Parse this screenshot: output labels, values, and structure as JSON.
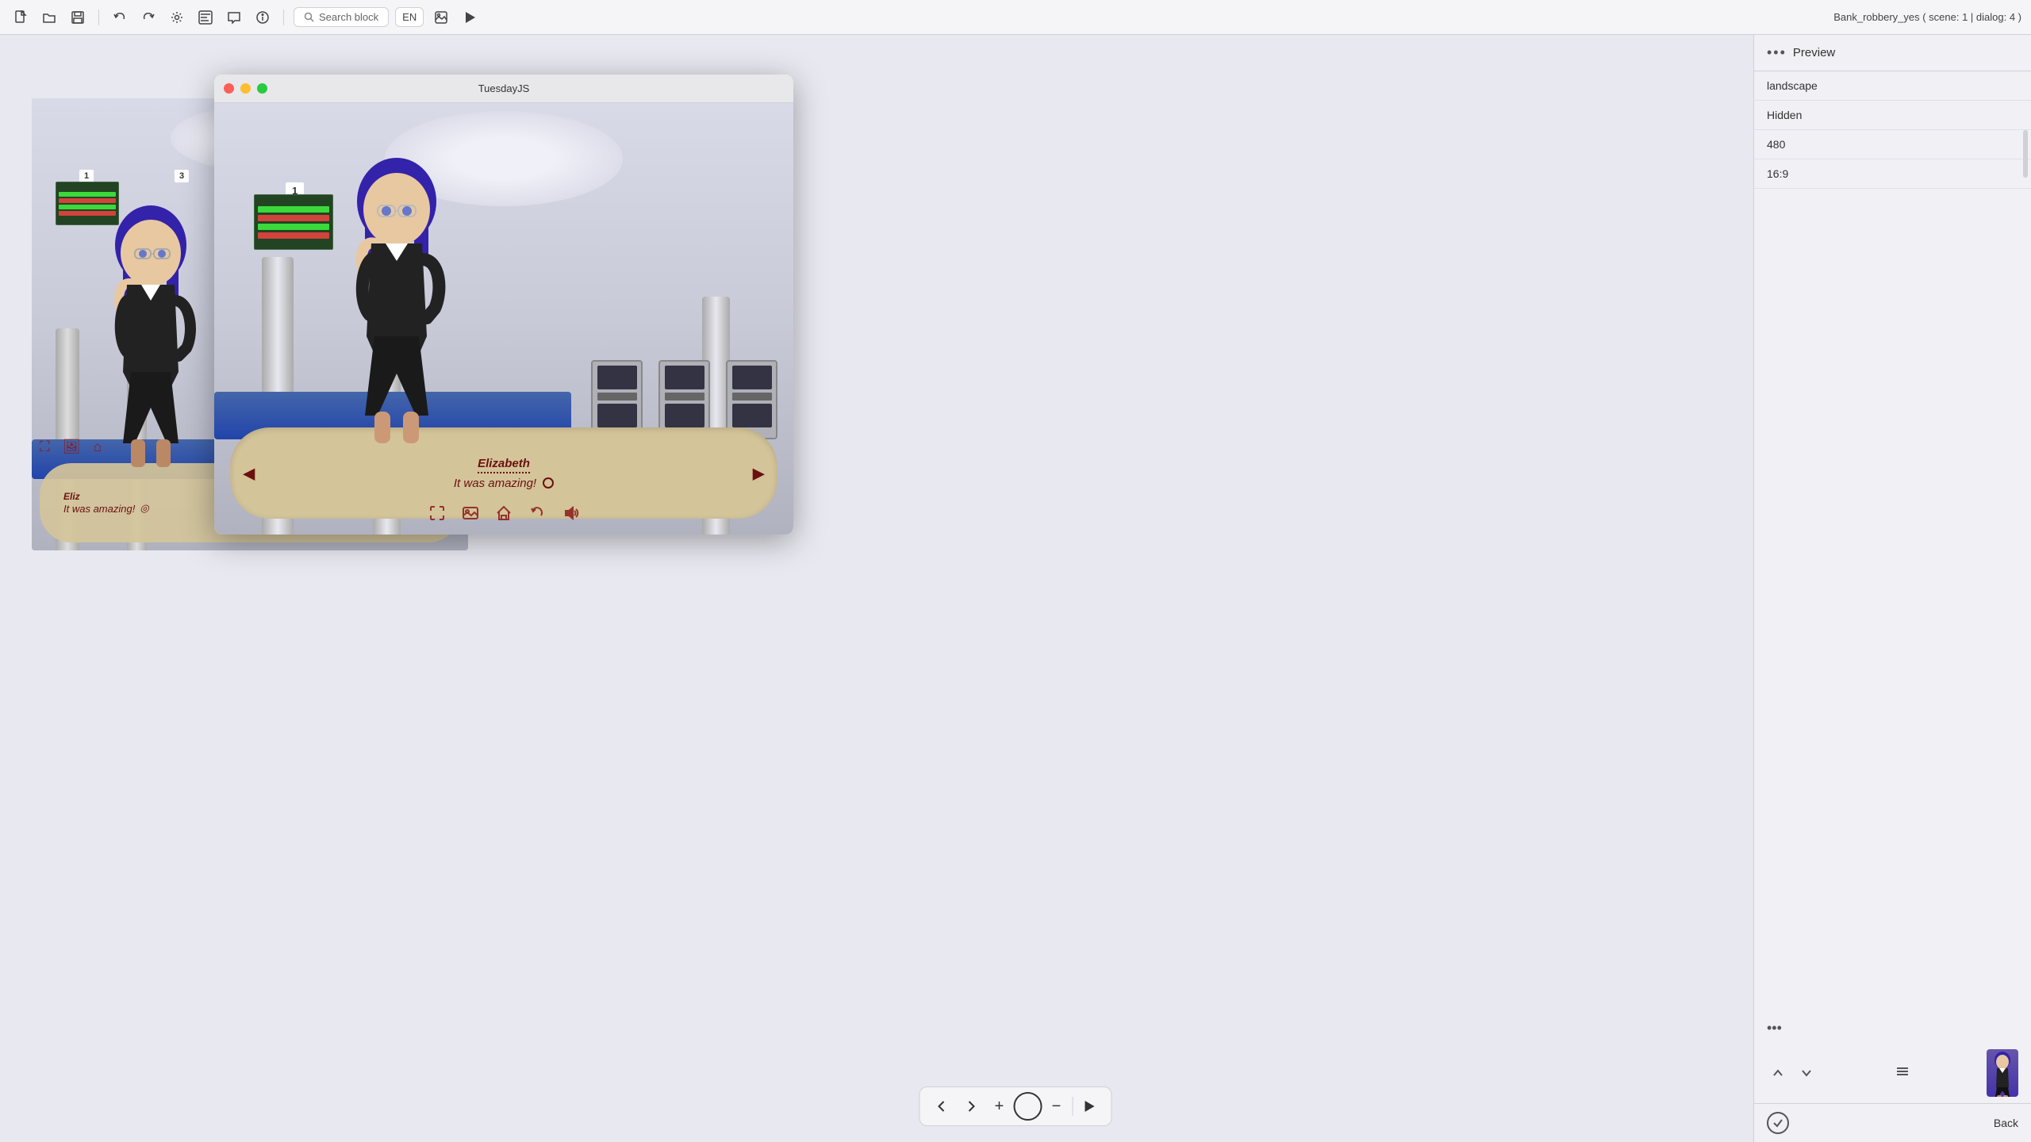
{
  "toolbar": {
    "title": "Bank_robbery_yes ( scene: 1 | dialog: 4 )",
    "search_placeholder": "Search block",
    "lang": "EN",
    "icons": [
      "new-file",
      "open-folder",
      "save",
      "undo",
      "redo",
      "settings",
      "code-block",
      "comment",
      "info"
    ]
  },
  "preview_window": {
    "title": "TuesdayJS",
    "traffic_lights": [
      "close",
      "minimize",
      "maximize"
    ]
  },
  "dialog": {
    "character_name": "Elizabeth",
    "text": "It was amazing!",
    "circle": "○",
    "arrow_left": "◀",
    "arrow_right": "▶"
  },
  "preview_bottom_icons": [
    "expand",
    "gallery",
    "home",
    "return",
    "volume"
  ],
  "bg_dialog": {
    "text": "It was amazing!",
    "circle": "◎",
    "name": "Eliz"
  },
  "bottom_nav": {
    "back": "◀",
    "forward": "▶",
    "add": "+",
    "circle": "○",
    "minus": "−",
    "play": "▶"
  },
  "right_panel": {
    "dots": "•••",
    "title": "Preview",
    "options": [
      {
        "label": "landscape",
        "value": ""
      },
      {
        "label": "Hidden",
        "value": ""
      },
      {
        "label": "480",
        "value": ""
      },
      {
        "label": "16:9",
        "value": ""
      }
    ],
    "dots2": "•••",
    "menu_lines": "≡",
    "back_label": "Back"
  }
}
